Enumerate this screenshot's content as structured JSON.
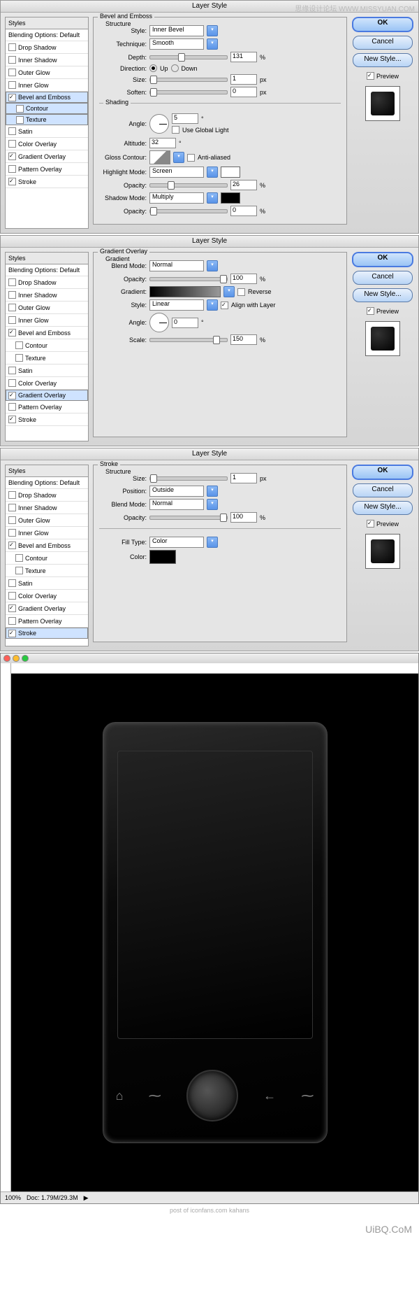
{
  "watermark": "思缘设计论坛 WWW.MISSYUAN.COM",
  "dialog_title": "Layer Style",
  "styles_panel": {
    "header": "Styles",
    "blending": "Blending Options: Default",
    "items": [
      {
        "label": "Drop Shadow",
        "checked": false
      },
      {
        "label": "Inner Shadow",
        "checked": false
      },
      {
        "label": "Outer Glow",
        "checked": false
      },
      {
        "label": "Inner Glow",
        "checked": false
      },
      {
        "label": "Bevel and Emboss",
        "checked": true
      },
      {
        "label": "Contour",
        "checked": false,
        "sub": true
      },
      {
        "label": "Texture",
        "checked": false,
        "sub": true
      },
      {
        "label": "Satin",
        "checked": false
      },
      {
        "label": "Color Overlay",
        "checked": false
      },
      {
        "label": "Gradient Overlay",
        "checked": true
      },
      {
        "label": "Pattern Overlay",
        "checked": false
      },
      {
        "label": "Stroke",
        "checked": true
      }
    ]
  },
  "buttons": {
    "ok": "OK",
    "cancel": "Cancel",
    "new_style": "New Style...",
    "preview": "Preview"
  },
  "bevel": {
    "title": "Bevel and Emboss",
    "structure": "Structure",
    "style_lbl": "Style:",
    "style_val": "Inner Bevel",
    "tech_lbl": "Technique:",
    "tech_val": "Smooth",
    "depth_lbl": "Depth:",
    "depth_val": "131",
    "pct": "%",
    "dir_lbl": "Direction:",
    "up": "Up",
    "down": "Down",
    "size_lbl": "Size:",
    "size_val": "1",
    "px": "px",
    "soften_lbl": "Soften:",
    "soften_val": "0",
    "shading": "Shading",
    "angle_lbl": "Angle:",
    "angle_val": "5",
    "global": "Use Global Light",
    "alt_lbl": "Altitude:",
    "alt_val": "32",
    "gloss_lbl": "Gloss Contour:",
    "aa": "Anti-aliased",
    "hl_lbl": "Highlight Mode:",
    "hl_val": "Screen",
    "op_lbl": "Opacity:",
    "hl_op": "26",
    "sh_lbl": "Shadow Mode:",
    "sh_val": "Multiply",
    "sh_op": "0"
  },
  "grad": {
    "title": "Gradient Overlay",
    "section": "Gradient",
    "blend_lbl": "Blend Mode:",
    "blend_val": "Normal",
    "op_lbl": "Opacity:",
    "op_val": "100",
    "pct": "%",
    "grad_lbl": "Gradient:",
    "reverse": "Reverse",
    "style_lbl": "Style:",
    "style_val": "Linear",
    "align": "Align with Layer",
    "angle_lbl": "Angle:",
    "angle_val": "0",
    "scale_lbl": "Scale:",
    "scale_val": "150"
  },
  "stroke": {
    "title": "Stroke",
    "structure": "Structure",
    "size_lbl": "Size:",
    "size_val": "1",
    "px": "px",
    "pos_lbl": "Position:",
    "pos_val": "Outside",
    "blend_lbl": "Blend Mode:",
    "blend_val": "Normal",
    "op_lbl": "Opacity:",
    "op_val": "100",
    "pct": "%",
    "fill_lbl": "Fill Type:",
    "fill_val": "Color",
    "color_lbl": "Color:"
  },
  "canvas": {
    "zoom": "100%",
    "doc": "Doc: 1.79M/29.3M"
  },
  "credit": "post of iconfans.com kahans",
  "footer": "UiBQ.CoM"
}
